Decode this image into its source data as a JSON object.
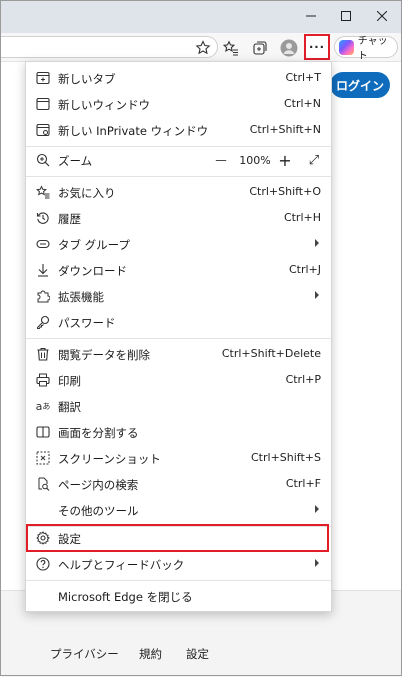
{
  "toolbar": {
    "chat_label": "チャット",
    "more_label": "···"
  },
  "page": {
    "login_label": "ログイン",
    "footer_links": [
      "プライバシー",
      "規約",
      "設定"
    ]
  },
  "menu": {
    "new_tab": {
      "label": "新しいタブ",
      "shortcut": "Ctrl+T"
    },
    "new_window": {
      "label": "新しいウィンドウ",
      "shortcut": "Ctrl+N"
    },
    "new_inprivate": {
      "label": "新しい InPrivate ウィンドウ",
      "shortcut": "Ctrl+Shift+N"
    },
    "zoom": {
      "label": "ズーム",
      "minus": "—",
      "value": "100%",
      "plus": "+",
      "expand": "⤢"
    },
    "favorites": {
      "label": "お気に入り",
      "shortcut": "Ctrl+Shift+O"
    },
    "history": {
      "label": "履歴",
      "shortcut": "Ctrl+H"
    },
    "tab_groups": {
      "label": "タブ グループ"
    },
    "downloads": {
      "label": "ダウンロード",
      "shortcut": "Ctrl+J"
    },
    "extensions": {
      "label": "拡張機能"
    },
    "passwords": {
      "label": "パスワード"
    },
    "clear_data": {
      "label": "閲覧データを削除",
      "shortcut": "Ctrl+Shift+Delete"
    },
    "print": {
      "label": "印刷",
      "shortcut": "Ctrl+P"
    },
    "translate": {
      "label": "翻訳"
    },
    "split_screen": {
      "label": "画面を分割する"
    },
    "screenshot": {
      "label": "スクリーンショット",
      "shortcut": "Ctrl+Shift+S"
    },
    "find": {
      "label": "ページ内の検索",
      "shortcut": "Ctrl+F"
    },
    "more_tools": {
      "label": "その他のツール"
    },
    "settings": {
      "label": "設定"
    },
    "help": {
      "label": "ヘルプとフィードバック"
    },
    "close_edge": {
      "label": "Microsoft Edge を閉じる"
    }
  },
  "colors": {
    "highlight": "#e11d2a",
    "login_bg": "#0f6cbd"
  }
}
